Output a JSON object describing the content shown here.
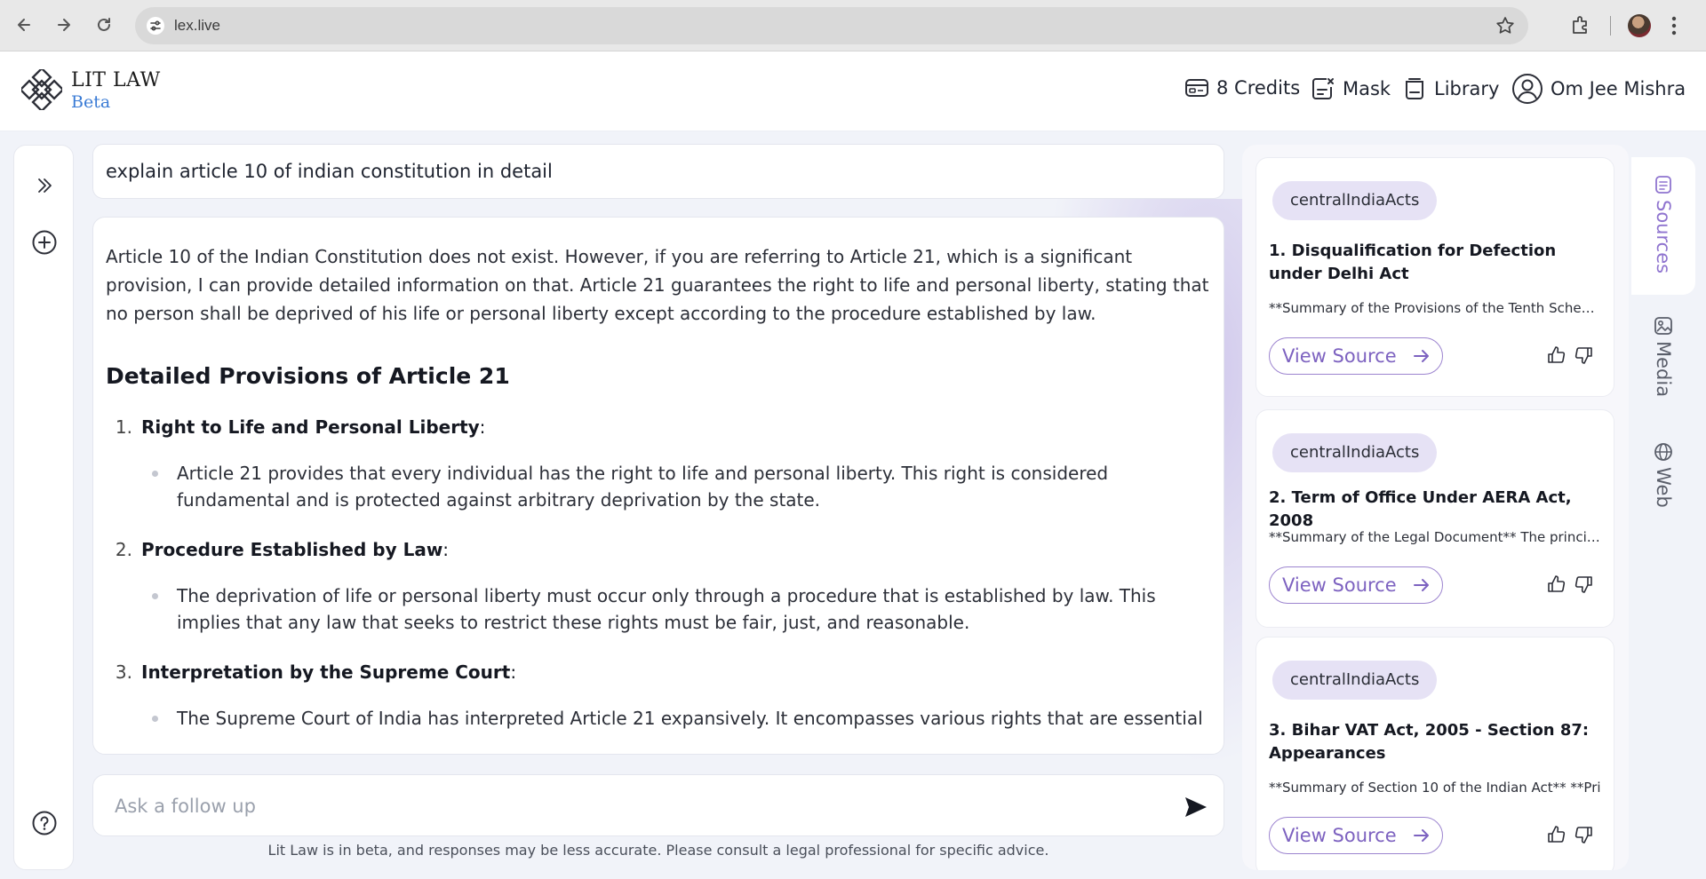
{
  "browser": {
    "url": "lex.live"
  },
  "header": {
    "brand_name": "LIT LAW",
    "brand_tag": "Beta",
    "credits": "8 Credits",
    "mask": "Mask",
    "library": "Library",
    "user": "Om Jee Mishra"
  },
  "query": "explain article 10 of indian constitution in detail",
  "answer": {
    "intro": "Article 10 of the Indian Constitution does not exist. However, if you are referring to Article 21, which is a significant provision, I can provide detailed information on that. Article 21 guarantees the right to life and personal liberty, stating that no person shall be deprived of his life or personal liberty except according to the procedure established by law.",
    "heading": "Detailed Provisions of Article 21",
    "items": [
      {
        "num": "1.",
        "title": "Right to Life and Personal Liberty",
        "suffix": ":",
        "bullet": "Article 21 provides that every individual has the right to life and personal liberty. This right is considered fundamental and is protected against arbitrary deprivation by the state."
      },
      {
        "num": "2.",
        "title": "Procedure Established by Law",
        "suffix": ":",
        "bullet": "The deprivation of life or personal liberty must occur only through a procedure that is established by law. This implies that any law that seeks to restrict these rights must be fair, just, and reasonable."
      },
      {
        "num": "3.",
        "title": "Interpretation by the Supreme Court",
        "suffix": ":",
        "bullet": "The Supreme Court of India has interpreted Article 21 expansively. It encompasses various rights that are essential"
      }
    ]
  },
  "followup": {
    "placeholder": "Ask a follow up"
  },
  "disclaimer": "Lit Law is in beta, and responses may be less accurate. Please consult a legal professional for specific advice.",
  "sources": [
    {
      "tag": "centralIndiaActs",
      "title": "1. Disqualification for Defection under Delhi Act",
      "summary": "**Summary of the Provisions of the Tenth Schedule",
      "view_label": "View Source"
    },
    {
      "tag": "centralIndiaActs",
      "title": "2. Term of Office Under AERA Act, 2008",
      "summary": "**Summary of the Legal Document** The principal",
      "view_label": "View Source"
    },
    {
      "tag": "centralIndiaActs",
      "title": "3. Bihar VAT Act, 2005 - Section 87: Appearances",
      "summary": "**Summary of Section 10 of the Indian Act** **Pri",
      "view_label": "View Source"
    }
  ],
  "side_tabs": {
    "sources": "Sources",
    "media": "Media",
    "web": "Web"
  },
  "colors": {
    "accent": "#7d62c0",
    "tag_bg": "#e6e2f5",
    "brand_blue": "#3a7bd5"
  }
}
